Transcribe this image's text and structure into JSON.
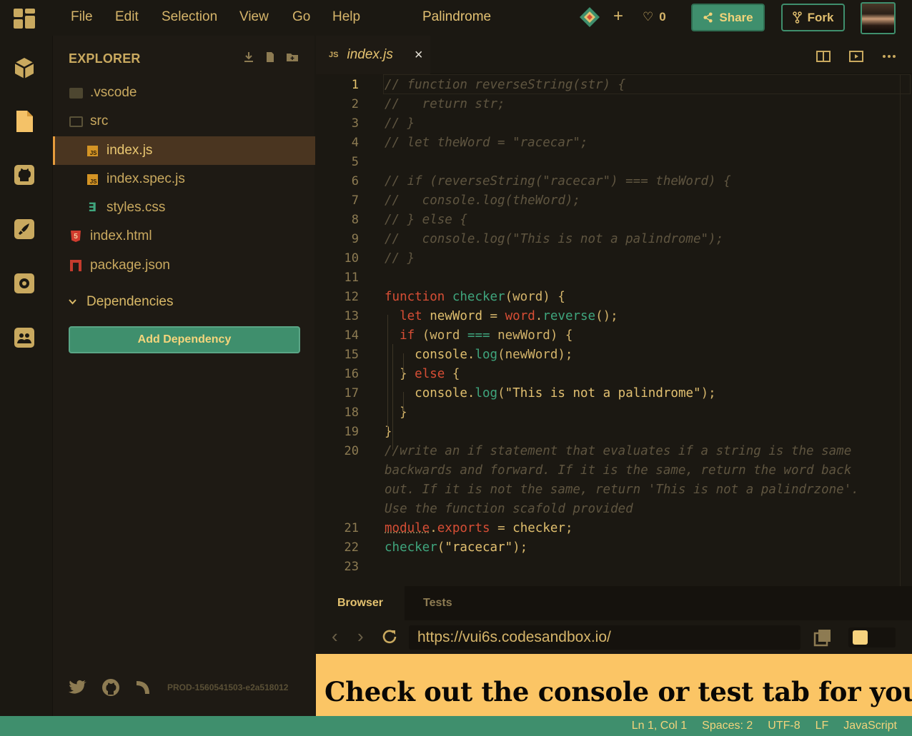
{
  "menu": [
    "File",
    "Edit",
    "Selection",
    "View",
    "Go",
    "Help"
  ],
  "title": "Palindrome",
  "likes_count": "0",
  "share_label": "Share",
  "fork_label": "Fork",
  "explorer": {
    "title": "EXPLORER",
    "files": [
      {
        "name": ".vscode",
        "type": "folder"
      },
      {
        "name": "src",
        "type": "folder-open"
      },
      {
        "name": "index.js",
        "type": "js",
        "active": true
      },
      {
        "name": "index.spec.js",
        "type": "js"
      },
      {
        "name": "styles.css",
        "type": "css"
      },
      {
        "name": "index.html",
        "type": "html"
      },
      {
        "name": "package.json",
        "type": "json"
      }
    ],
    "dependencies_label": "Dependencies",
    "add_dependency_label": "Add Dependency",
    "build_id": "PROD-1560541503-e2a518012"
  },
  "editor": {
    "tab_name": "index.js",
    "tab_lang": "JS",
    "close_glyph": "×",
    "line_numbers": [
      "1",
      "2",
      "3",
      "4",
      "5",
      "6",
      "7",
      "8",
      "9",
      "10",
      "11",
      "12",
      "13",
      "14",
      "15",
      "16",
      "17",
      "18",
      "19",
      "20",
      "21",
      "22",
      "23"
    ]
  },
  "browser": {
    "tabs": [
      "Browser",
      "Tests"
    ],
    "url": "https://vui6s.codesandbox.io/",
    "preview_text": "Check out the console or test tab for your"
  },
  "status": {
    "cursor": "Ln 1, Col 1",
    "spaces": "Spaces: 2",
    "encoding": "UTF-8",
    "eol": "LF",
    "language": "JavaScript"
  },
  "colors": {
    "accent_green": "#3f8f6d",
    "text_gold": "#c9a95f",
    "background": "#1b1812",
    "active_tab": "#e59b3c"
  }
}
